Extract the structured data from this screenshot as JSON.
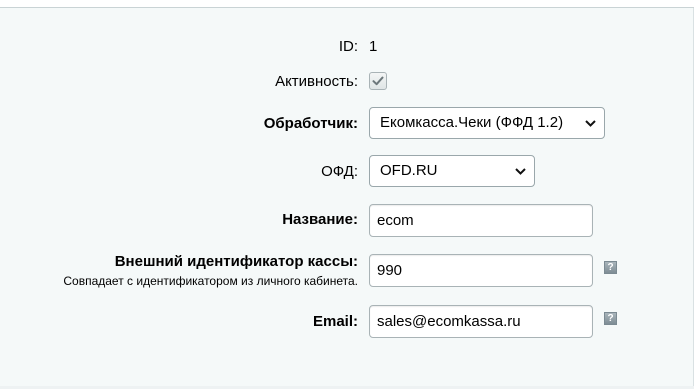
{
  "form": {
    "id": {
      "label": "ID:",
      "value": "1"
    },
    "active": {
      "label": "Активность:",
      "checked": true
    },
    "handler": {
      "label": "Обработчик:",
      "value": "Екомкасса.Чеки (ФФД 1.2)"
    },
    "ofd": {
      "label": "ОФД:",
      "value": "OFD.RU"
    },
    "name": {
      "label": "Название:",
      "value": "ecom"
    },
    "external_id": {
      "label": "Внешний идентификатор кассы:",
      "hint": "Совпадает с идентификатором из личного кабинета.",
      "value": "990",
      "help": "?"
    },
    "email": {
      "label": "Email:",
      "value": "sales@ecomkassa.ru",
      "help": "?"
    }
  }
}
